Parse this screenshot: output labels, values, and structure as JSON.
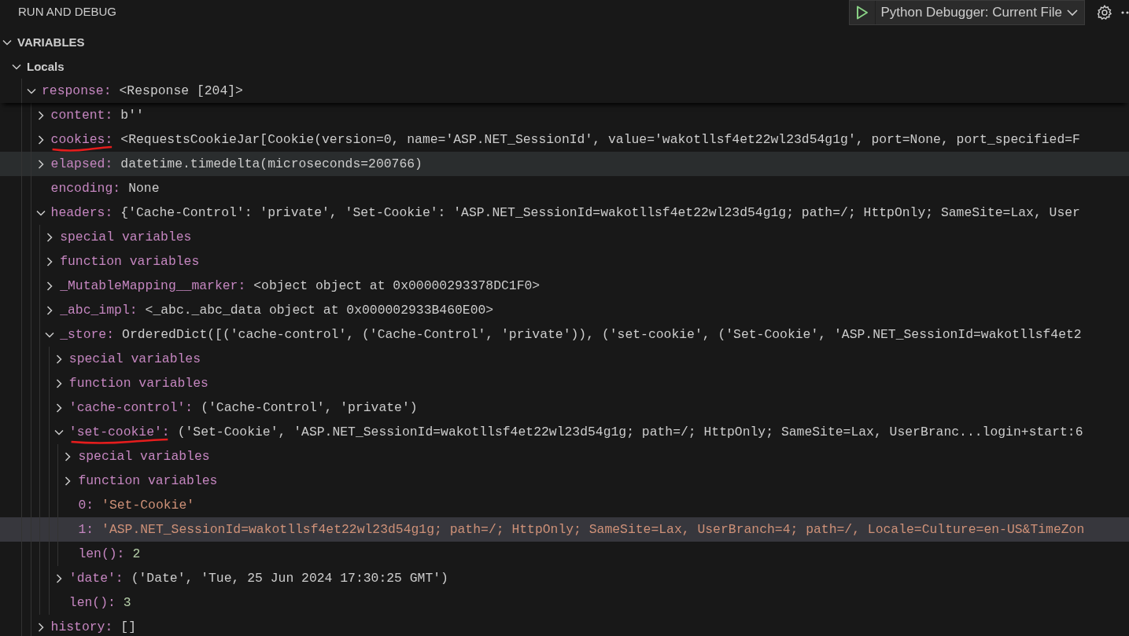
{
  "panel": {
    "title": "RUN AND DEBUG",
    "config": "Python Debugger: Current File"
  },
  "section": {
    "title": "VARIABLES",
    "expanded": true
  },
  "scope": {
    "label": "Locals",
    "expanded": true
  },
  "variables": [
    {
      "name": "response:",
      "value": "<Response [204]>",
      "expanded": true,
      "selected": false,
      "children": [
        {
          "name": "content:",
          "value": "b''",
          "expanded": false,
          "selected": false
        },
        {
          "name": "cookies:",
          "value": "<RequestsCookieJar[Cookie(version=0, name='ASP.NET_SessionId', value='wakotllsf4et22wl23d54g1g', port=None, port_specified=F",
          "expanded": false,
          "selected": false,
          "underlined": true
        },
        {
          "name": "elapsed:",
          "value": "datetime.timedelta(microseconds=200766)",
          "expanded": false,
          "selected": false,
          "hovered": true
        },
        {
          "name": "encoding:",
          "value": "None",
          "selected": false
        },
        {
          "name": "headers:",
          "value": "{'Cache-Control': 'private', 'Set-Cookie': 'ASP.NET_SessionId=wakotllsf4et22wl23d54g1g; path=/; HttpOnly; SameSite=Lax, User",
          "expanded": true,
          "selected": false,
          "children": [
            {
              "name": "special variables",
              "expanded": false,
              "selected": false
            },
            {
              "name": "function variables",
              "expanded": false,
              "selected": false
            },
            {
              "name": "_MutableMapping__marker:",
              "value": "<object object at 0x00000293378DC1F0>",
              "expanded": false,
              "selected": false
            },
            {
              "name": "_abc_impl:",
              "value": "<_abc._abc_data object at 0x000002933B460E00>",
              "expanded": false,
              "selected": false
            },
            {
              "name": "_store:",
              "value": "OrderedDict([('cache-control', ('Cache-Control', 'private')), ('set-cookie', ('Set-Cookie', 'ASP.NET_SessionId=wakotllsf4et2",
              "expanded": true,
              "selected": false,
              "children": [
                {
                  "name": "special variables",
                  "expanded": false,
                  "selected": false
                },
                {
                  "name": "function variables",
                  "expanded": false,
                  "selected": false
                },
                {
                  "name": "'cache-control':",
                  "value": "('Cache-Control', 'private')",
                  "expanded": false,
                  "selected": false
                },
                {
                  "name": "'set-cookie':",
                  "value": "('Set-Cookie', 'ASP.NET_SessionId=wakotllsf4et22wl23d54g1g; path=/; HttpOnly; SameSite=Lax, UserBranc...login+start:6",
                  "expanded": true,
                  "selected": false,
                  "underlined": true,
                  "children": [
                    {
                      "name": "special variables",
                      "expanded": false,
                      "selected": false
                    },
                    {
                      "name": "function variables",
                      "expanded": false,
                      "selected": false
                    },
                    {
                      "name": "0:",
                      "value": "'Set-Cookie'",
                      "kind": "string",
                      "selected": false
                    },
                    {
                      "name": "1:",
                      "value": "'ASP.NET_SessionId=wakotllsf4et22wl23d54g1g; path=/; HttpOnly; SameSite=Lax, UserBranch=4; path=/, Locale=Culture=en-US&TimeZon",
                      "kind": "string",
                      "selected": true
                    },
                    {
                      "name": "len():",
                      "value": "2",
                      "kind": "number",
                      "selected": false
                    }
                  ]
                },
                {
                  "name": "'date':",
                  "value": "('Date', 'Tue, 25 Jun 2024 17:30:25 GMT')",
                  "expanded": false,
                  "selected": false
                },
                {
                  "name": "len():",
                  "value": "3",
                  "kind": "number",
                  "selected": false
                }
              ]
            }
          ]
        },
        {
          "name": "history:",
          "value": "[]",
          "expanded": false,
          "selected": false
        }
      ]
    }
  ]
}
